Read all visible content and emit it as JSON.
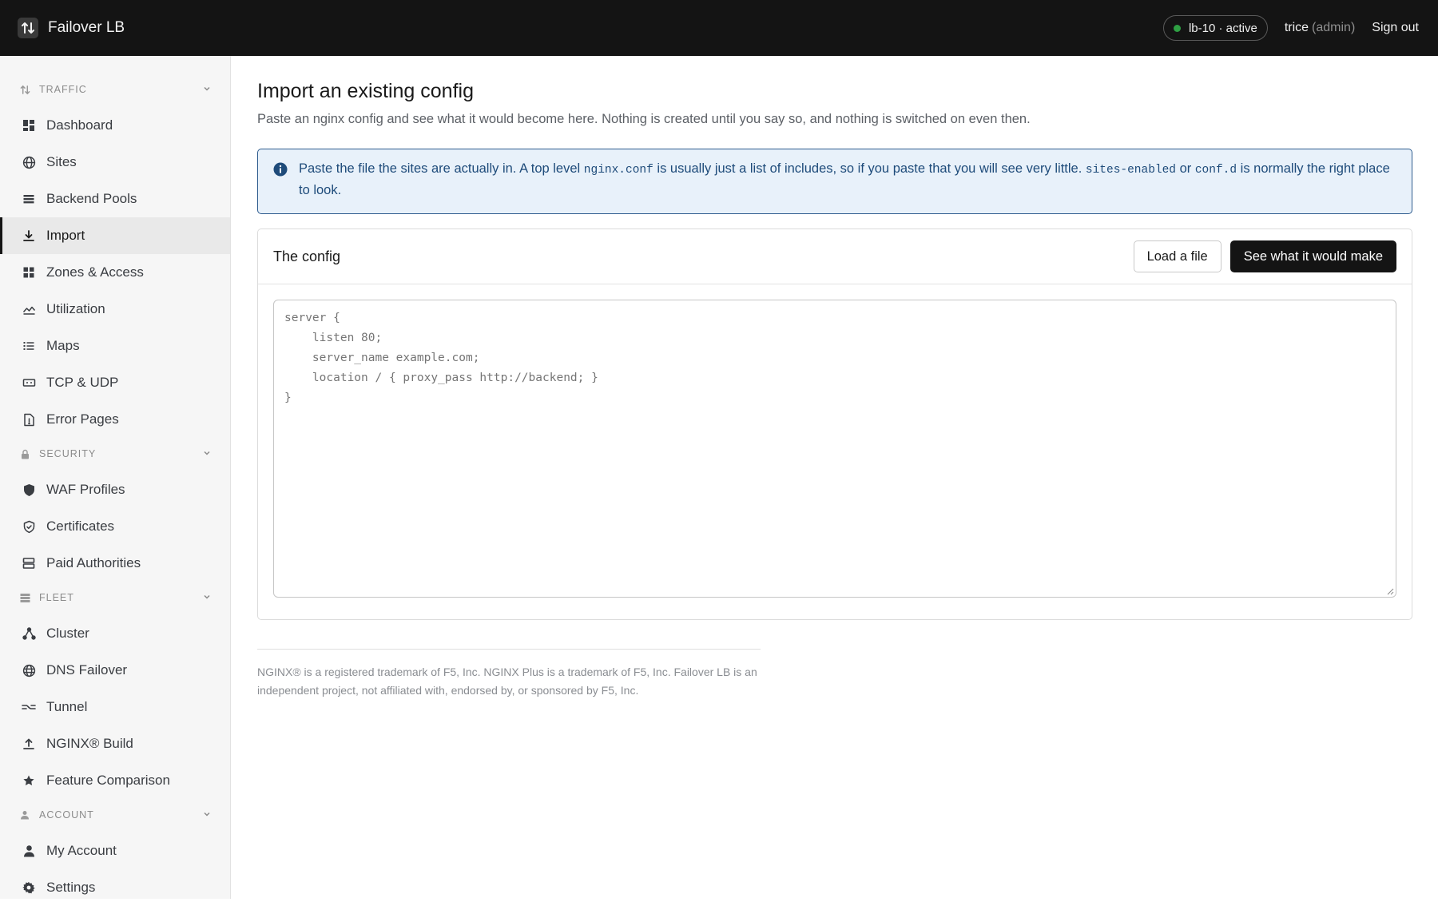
{
  "app": {
    "name": "Failover LB",
    "logo_icon": "updown-arrows-icon"
  },
  "header": {
    "status": {
      "label": "lb-10 · active",
      "color": "#2ea043"
    },
    "user": {
      "name": "trice",
      "role": "(admin)"
    },
    "signout_label": "Sign out"
  },
  "sidebar": {
    "sections": [
      {
        "title": "TRAFFIC",
        "icon": "updown-arrows-icon",
        "items": [
          {
            "label": "Dashboard",
            "icon": "grid-icon"
          },
          {
            "label": "Sites",
            "icon": "globe-icon"
          },
          {
            "label": "Backend Pools",
            "icon": "stack-icon"
          },
          {
            "label": "Import",
            "icon": "download-icon",
            "active": true
          },
          {
            "label": "Zones & Access",
            "icon": "grid-icon"
          },
          {
            "label": "Utilization",
            "icon": "chart-line-icon"
          },
          {
            "label": "Maps",
            "icon": "list-icon"
          },
          {
            "label": "TCP & UDP",
            "icon": "port-icon"
          },
          {
            "label": "Error Pages",
            "icon": "file-warning-icon"
          }
        ]
      },
      {
        "title": "SECURITY",
        "icon": "lock-icon",
        "items": [
          {
            "label": "WAF Profiles",
            "icon": "shield-filled-icon"
          },
          {
            "label": "Certificates",
            "icon": "shield-check-icon"
          },
          {
            "label": "Paid Authorities",
            "icon": "server-icon"
          }
        ]
      },
      {
        "title": "FLEET",
        "icon": "server-icon",
        "items": [
          {
            "label": "Cluster",
            "icon": "nodes-icon"
          },
          {
            "label": "DNS Failover",
            "icon": "globe-icon"
          },
          {
            "label": "Tunnel",
            "icon": "tunnel-icon"
          },
          {
            "label": "NGINX® Build",
            "icon": "upload-icon"
          },
          {
            "label": "Feature Comparison",
            "icon": "star-icon"
          }
        ]
      },
      {
        "title": "ACCOUNT",
        "icon": "user-icon",
        "items": [
          {
            "label": "My Account",
            "icon": "user-icon"
          },
          {
            "label": "Settings",
            "icon": "gear-icon"
          }
        ]
      }
    ]
  },
  "main": {
    "title": "Import an existing config",
    "subtitle": "Paste an nginx config and see what it would become here. Nothing is created until you say so, and nothing is switched on even then.",
    "alert": {
      "icon": "info-icon",
      "part1": "Paste the file the sites are actually in. A top level ",
      "code1": "nginx.conf",
      "part2": " is usually just a list of includes, so if you paste that you will see very little. ",
      "code2": "sites-enabled",
      "part3": " or ",
      "code3": "conf.d",
      "part4": " is normally the right place to look."
    },
    "card": {
      "title": "The config",
      "load_button": "Load a file",
      "submit_button": "See what it would make",
      "placeholder": "server {\n    listen 80;\n    server_name example.com;\n    location / { proxy_pass http://backend; }\n}"
    },
    "footer": "NGINX® is a registered trademark of F5, Inc. NGINX Plus is a trademark of F5, Inc. Failover LB is an independent project, not affiliated with, endorsed by, or sponsored by F5, Inc."
  }
}
